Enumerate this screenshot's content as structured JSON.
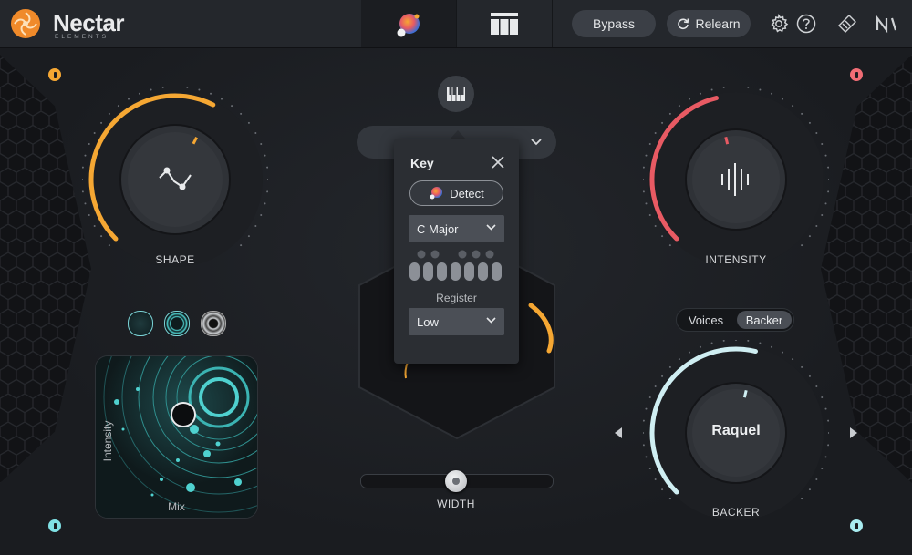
{
  "app": {
    "name": "Nectar",
    "subtitle": "ELEMENTS"
  },
  "topbar": {
    "bypass_label": "Bypass",
    "relearn_label": "Relearn"
  },
  "knobs": {
    "shape": {
      "label": "SHAPE",
      "value": 0.6
    },
    "intensity": {
      "label": "INTENSITY",
      "value": 0.45
    },
    "backer": {
      "label": "BACKER",
      "value_text": "Raquel",
      "value": 0.55
    }
  },
  "mix_pad": {
    "x_label": "Mix",
    "y_label": "Intensity"
  },
  "width": {
    "label": "WIDTH",
    "value": 0.5
  },
  "key_popup": {
    "title": "Key",
    "detect_label": "Detect",
    "key_value": "C Major",
    "register_label": "Register",
    "register_value": "Low"
  },
  "voice_toggle": {
    "voices_label": "Voices",
    "backer_label": "Backer",
    "selected": "Backer"
  },
  "colors": {
    "shape_accent": "#f5a733",
    "intensity_accent": "#e85a63",
    "backer_accent": "#cfeef2",
    "mix_accent": "#4fd1cf"
  }
}
